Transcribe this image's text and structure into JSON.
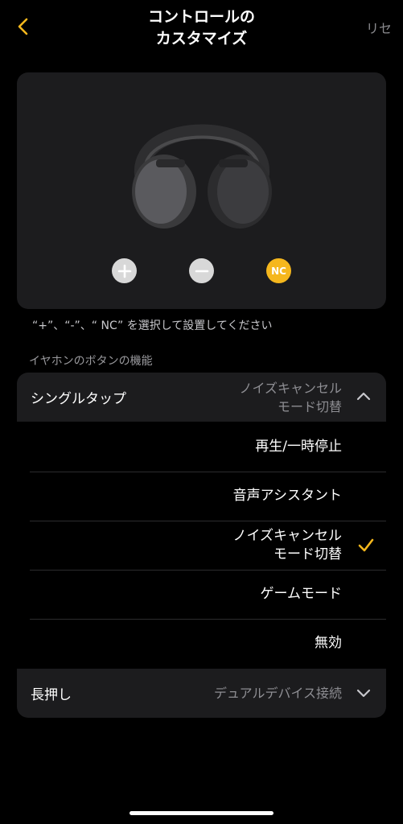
{
  "header": {
    "title_line1": "コントロールの",
    "title_line2": "カスタマイズ",
    "reset_label": "リセ"
  },
  "hero": {
    "nc_label": "NC"
  },
  "hint": "“+”、“-”、“ NC” を選択して設置してください",
  "section_label": "イヤホンのボタンの機能",
  "single_tap": {
    "label": "シングルタップ",
    "value_line1": "ノイズキャンセル",
    "value_line2": "モード切替"
  },
  "options": [
    {
      "label": "再生/一時停止"
    },
    {
      "label": "音声アシスタント"
    },
    {
      "label_line1": "ノイズキャンセル",
      "label_line2": "モード切替",
      "selected": true
    },
    {
      "label": "ゲームモード"
    },
    {
      "label": "無効"
    }
  ],
  "long_press": {
    "label": "長押し",
    "value": "デュアルデバイス接続"
  },
  "colors": {
    "accent": "#f5b71d",
    "card": "#1c1c1e",
    "secondary_text": "#8e8e93"
  }
}
